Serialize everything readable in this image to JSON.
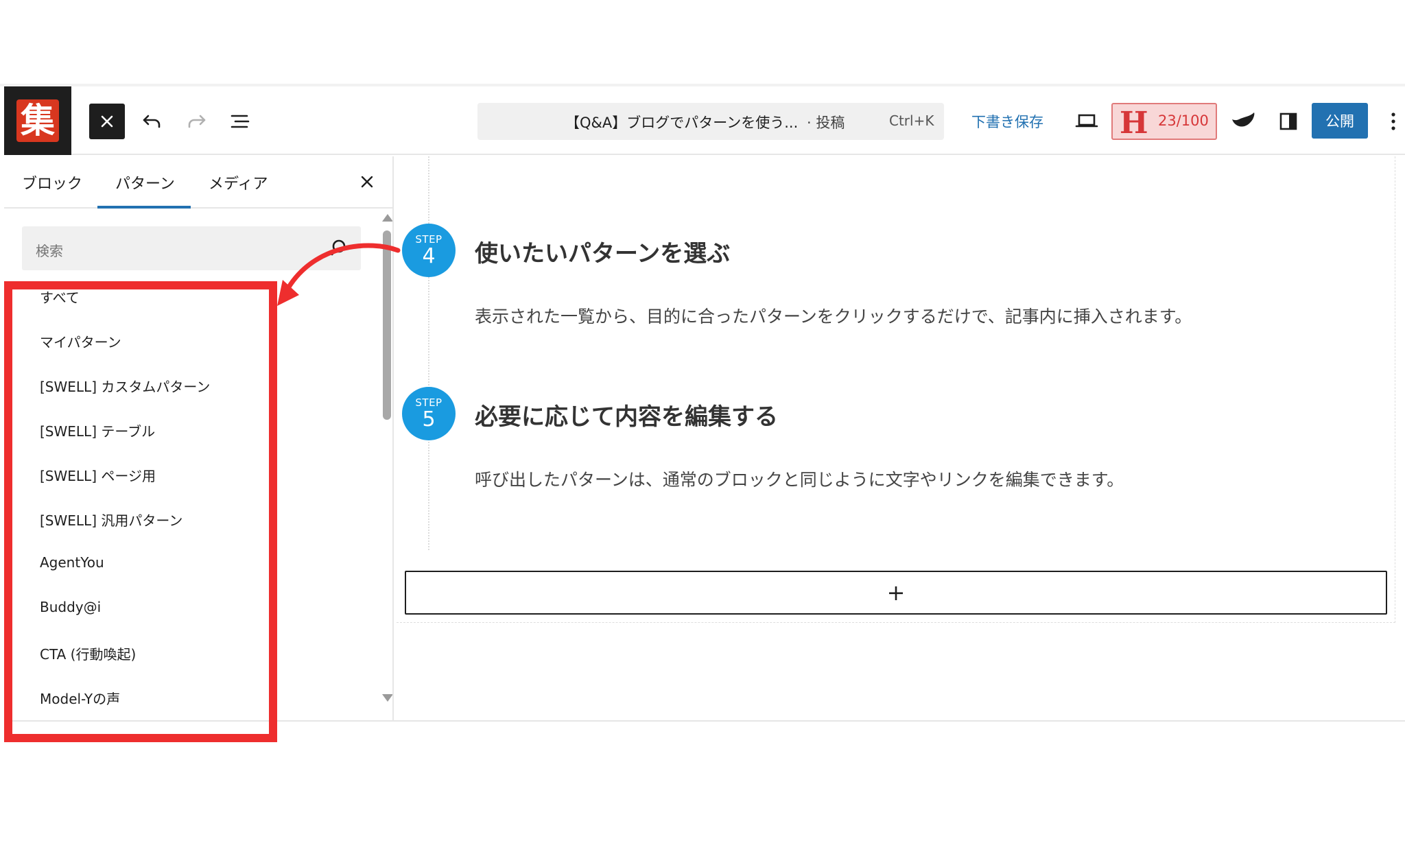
{
  "toolbar": {
    "logo_glyph": "集",
    "close_label": "✕",
    "document_title": "【Q&A】ブログでパターンを使う...",
    "document_kind": "· 投稿",
    "shortcut": "Ctrl+K",
    "save_draft": "下書き保存",
    "score_letter": "H",
    "score": "23/100",
    "publish": "公開"
  },
  "inserter": {
    "tabs": [
      "ブロック",
      "パターン",
      "メディア"
    ],
    "active_tab": "パターン",
    "search_placeholder": "検索",
    "categories": [
      "すべて",
      "マイパターン",
      "[SWELL] カスタムパターン",
      "[SWELL] テーブル",
      "[SWELL] ページ用",
      "[SWELL] 汎用パターン",
      "AgentYou",
      "Buddy@i",
      "CTA (行動喚起)",
      "Model-Yの声"
    ]
  },
  "content": {
    "steps": [
      {
        "label": "STEP",
        "number": "4",
        "title": "使いたいパターンを選ぶ",
        "text": "表示された一覧から、目的に合ったパターンをクリックするだけで、記事内に挿入されます。"
      },
      {
        "label": "STEP",
        "number": "5",
        "title": "必要に応じて内容を編集する",
        "text": "呼び出したパターンは、通常のブロックと同じように文字やリンクを編集できます。"
      }
    ],
    "add_block": "+"
  },
  "colors": {
    "accent": "#2271b1",
    "step_badge": "#1a9be0",
    "highlight": "#ee2e2e",
    "score_bg": "#f8d7d7",
    "score_text": "#d63638"
  },
  "icons": [
    "close-icon",
    "undo-icon",
    "redo-icon",
    "document-overview-icon",
    "preview-icon",
    "swell-icon",
    "settings-sidebar-icon",
    "more-options-icon",
    "search-icon"
  ]
}
